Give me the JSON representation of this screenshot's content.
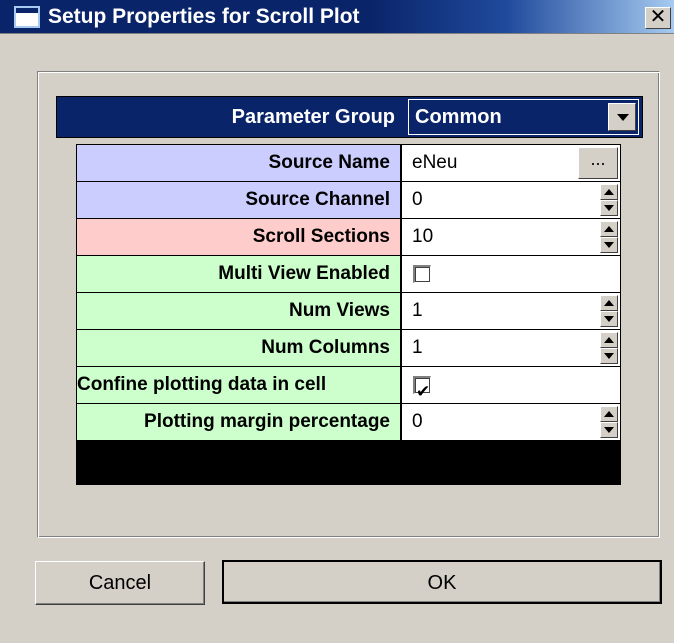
{
  "window": {
    "title": "Setup Properties for Scroll Plot",
    "close_glyph": "✕"
  },
  "parameter_group": {
    "label": "Parameter Group",
    "selected": "Common"
  },
  "properties": [
    {
      "label": "Source Name",
      "value": "eNeu",
      "control": "ellipsis",
      "color": "#cccdff"
    },
    {
      "label": "Source Channel",
      "value": "0",
      "control": "spinner",
      "color": "#cccdff"
    },
    {
      "label": "Scroll Sections",
      "value": "10",
      "control": "spinner",
      "color": "#ffcccc"
    },
    {
      "label": "Multi View Enabled",
      "value": "",
      "control": "checkbox",
      "checked": false,
      "color": "#ccffcc"
    },
    {
      "label": "Num Views",
      "value": "1",
      "control": "spinner",
      "color": "#ccffcc"
    },
    {
      "label": "Num Columns",
      "value": "1",
      "control": "spinner",
      "color": "#ccffcc"
    },
    {
      "label": "Confine plotting data in cell",
      "value": "",
      "control": "checkbox",
      "checked": true,
      "color": "#ccffcc"
    },
    {
      "label": "Plotting margin percentage",
      "value": "0",
      "control": "spinner",
      "color": "#ccffcc"
    }
  ],
  "ellipsis_label": "...",
  "buttons": {
    "cancel": "Cancel",
    "ok": "OK"
  }
}
